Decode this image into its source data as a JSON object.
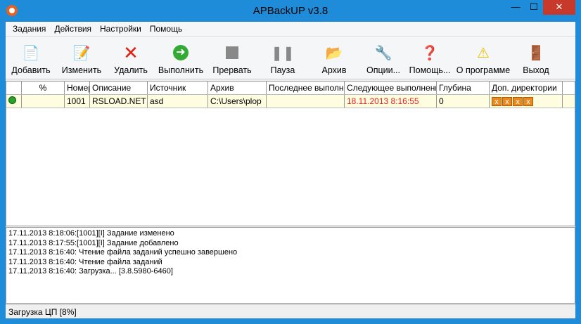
{
  "title": "APBackUP v3.8",
  "menu": [
    "Задания",
    "Действия",
    "Настройки",
    "Помощь"
  ],
  "toolbar": [
    {
      "label": "Добавить",
      "icon": "add-task-icon"
    },
    {
      "label": "Изменить",
      "icon": "edit-icon"
    },
    {
      "label": "Удалить",
      "icon": "delete-icon"
    },
    {
      "label": "Выполнить",
      "icon": "run-icon"
    },
    {
      "label": "Прервать",
      "icon": "stop-icon"
    },
    {
      "label": "Пауза",
      "icon": "pause-icon"
    },
    {
      "label": "Архив",
      "icon": "archive-folder-icon"
    },
    {
      "label": "Опции...",
      "icon": "options-icon"
    },
    {
      "label": "Помощь...",
      "icon": "help-icon"
    },
    {
      "label": "О программе",
      "icon": "about-icon"
    },
    {
      "label": "Выход",
      "icon": "exit-icon"
    }
  ],
  "columns": [
    "",
    "%",
    "Номер",
    "Описание",
    "Источник",
    "Архив",
    "Последнее выполнение",
    "Следующее выполнение",
    "Глубина",
    "Доп. директории"
  ],
  "rows": [
    {
      "percent": "",
      "number": "1001",
      "description": "RSLOAD.NET",
      "source": "asd",
      "archive": "C:\\Users\\plop",
      "last": "",
      "next": "18.11.2013 8:16:55",
      "depth": "0",
      "status_color": "#2ca02c"
    }
  ],
  "log": [
    "17.11.2013 8:18:06:[1001][I] Задание изменено",
    "17.11.2013 8:17:55:[1001][I] Задание добавлено",
    "17.11.2013 8:16:40: Чтение файла заданий успешно завершено",
    "17.11.2013 8:16:40: Чтение файла заданий",
    "17.11.2013 8:16:40: Загрузка... [3.8.5980-6460]"
  ],
  "status": "Загрузка ЦП [8%]"
}
